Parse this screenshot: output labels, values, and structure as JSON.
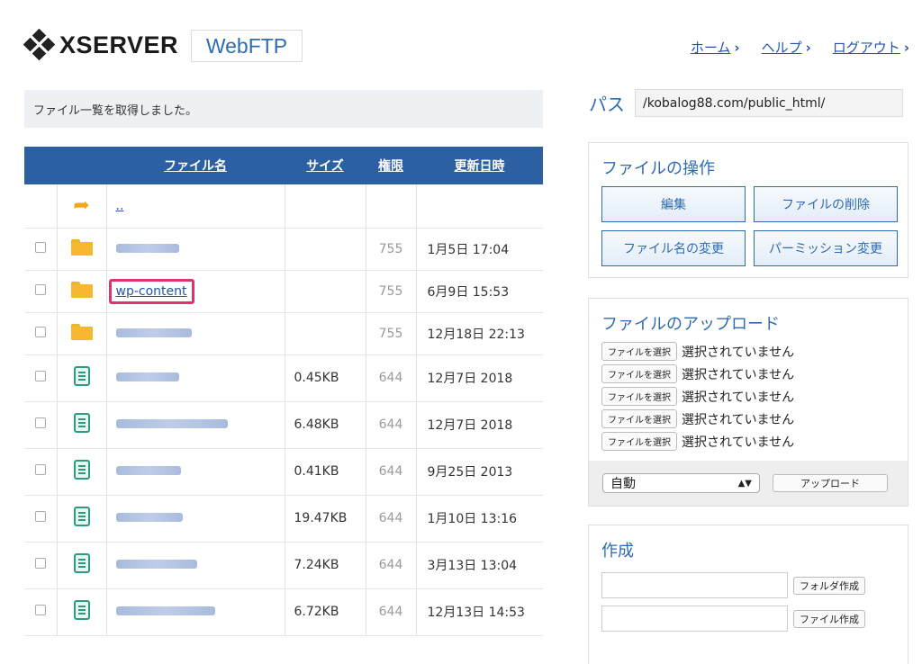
{
  "header": {
    "logo_text": "XSERVER",
    "app_name": "WebFTP",
    "nav": [
      {
        "label": "ホーム"
      },
      {
        "label": "ヘルプ"
      },
      {
        "label": "ログアウト"
      }
    ],
    "nav_chevron": "›"
  },
  "status": {
    "message": "ファイル一覧を取得しました。"
  },
  "table": {
    "columns": {
      "name": "ファイル名",
      "size": "サイズ",
      "perm": "権限",
      "date": "更新日時"
    },
    "parent_link": "..",
    "rows": [
      {
        "type": "folder",
        "name": "",
        "size": "",
        "perm": "755",
        "date": "1月5日 17:04"
      },
      {
        "type": "folder",
        "name": "wp-content",
        "size": "",
        "perm": "755",
        "date": "6月9日 15:53"
      },
      {
        "type": "folder",
        "name": "",
        "size": "",
        "perm": "755",
        "date": "12月18日 22:13"
      },
      {
        "type": "file",
        "name": "",
        "size": "0.45KB",
        "perm": "644",
        "date": "12月7日 2018"
      },
      {
        "type": "file",
        "name": "",
        "size": "6.48KB",
        "perm": "644",
        "date": "12月7日 2018"
      },
      {
        "type": "file",
        "name": "",
        "size": "0.41KB",
        "perm": "644",
        "date": "9月25日 2013"
      },
      {
        "type": "file",
        "name": "",
        "size": "19.47KB",
        "perm": "644",
        "date": "1月10日 13:16"
      },
      {
        "type": "file",
        "name": "",
        "size": "7.24KB",
        "perm": "644",
        "date": "3月13日 13:04"
      },
      {
        "type": "file",
        "name": "",
        "size": "6.72KB",
        "perm": "644",
        "date": "12月13日 14:53"
      }
    ]
  },
  "path": {
    "label": "パス",
    "value": "/kobalog88.com/public_html/"
  },
  "operations": {
    "title": "ファイルの操作",
    "buttons": [
      "編集",
      "ファイルの削除",
      "ファイル名の変更",
      "パーミッション変更"
    ]
  },
  "upload": {
    "title": "ファイルのアップロード",
    "choose_label": "ファイルを選択",
    "none_selected": "選択されていません",
    "mode": "自動",
    "upload_button": "アップロード"
  },
  "create": {
    "title": "作成",
    "folder_button": "フォルダ作成",
    "file_button": "ファイル作成"
  },
  "colors": {
    "accent": "#2d6cb5",
    "table_header": "#2d5fa3",
    "highlight": "#e0336c",
    "folder": "#f5b82e",
    "file": "#2e9a7f"
  }
}
